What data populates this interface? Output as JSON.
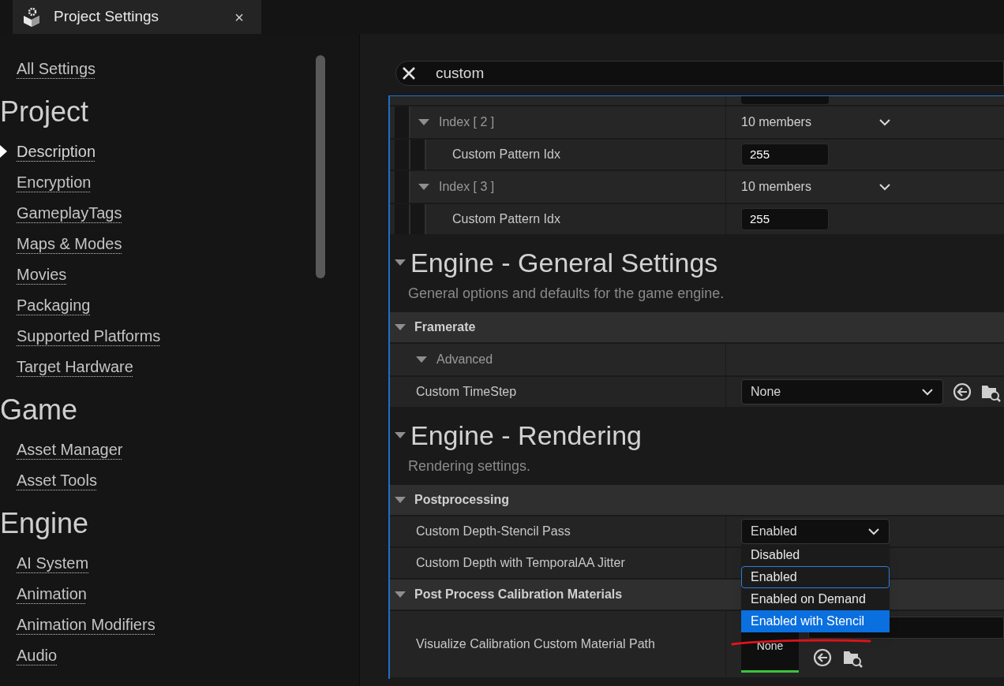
{
  "tab": {
    "title": "Project Settings",
    "close": "×"
  },
  "sidebar": {
    "all_settings": {
      "label": "All Settings",
      "selected": false
    },
    "sections": [
      {
        "title": "Project",
        "items": [
          {
            "label": "Description",
            "selected": true
          },
          {
            "label": "Encryption",
            "selected": false
          },
          {
            "label": "GameplayTags",
            "selected": false
          },
          {
            "label": "Maps & Modes",
            "selected": false
          },
          {
            "label": "Movies",
            "selected": false
          },
          {
            "label": "Packaging",
            "selected": false
          },
          {
            "label": "Supported Platforms",
            "selected": false
          },
          {
            "label": "Target Hardware",
            "selected": false
          }
        ]
      },
      {
        "title": "Game",
        "items": [
          {
            "label": "Asset Manager",
            "selected": false
          },
          {
            "label": "Asset Tools",
            "selected": false
          }
        ]
      },
      {
        "title": "Engine",
        "items": [
          {
            "label": "AI System",
            "selected": false
          },
          {
            "label": "Animation",
            "selected": false
          },
          {
            "label": "Animation Modifiers",
            "selected": false
          },
          {
            "label": "Audio",
            "selected": false
          }
        ]
      }
    ]
  },
  "search": {
    "value": "custom"
  },
  "details": {
    "scrolled_rows": [
      {
        "kind": "group",
        "label": "Index [ 2 ]",
        "value": "10 members",
        "expanded": true,
        "children": [
          {
            "kind": "property",
            "label": "Custom Pattern Idx",
            "value": {
              "kind": "number",
              "text": "255"
            }
          }
        ]
      },
      {
        "kind": "group",
        "label": "Index [ 3 ]",
        "value": "10 members",
        "expanded": true,
        "children": [
          {
            "kind": "property",
            "label": "Custom Pattern Idx",
            "value": {
              "kind": "number",
              "text": "255"
            }
          }
        ]
      }
    ],
    "sections": [
      {
        "title": "Engine - General Settings",
        "description": "General options and defaults for the game engine.",
        "expanded": true,
        "children": [
          {
            "kind": "category",
            "label": "Framerate",
            "expanded": true,
            "children": [
              {
                "kind": "group",
                "label": "Advanced",
                "expanded": true
              },
              {
                "kind": "property",
                "label": "Custom TimeStep",
                "value": {
                  "kind": "class_picker",
                  "text": "None"
                }
              }
            ]
          }
        ]
      },
      {
        "title": "Engine - Rendering",
        "description": "Rendering settings.",
        "expanded": true,
        "children": [
          {
            "kind": "category",
            "label": "Postprocessing",
            "expanded": true,
            "children": [
              {
                "kind": "property",
                "label": "Custom Depth-Stencil Pass",
                "value": {
                  "kind": "combo",
                  "text": "Enabled"
                },
                "open": true,
                "options": [
                  {
                    "label": "Disabled",
                    "selected": false,
                    "hovered": false
                  },
                  {
                    "label": "Enabled",
                    "selected": true,
                    "hovered": false
                  },
                  {
                    "label": "Enabled on Demand",
                    "selected": false,
                    "hovered": false
                  },
                  {
                    "label": "Enabled with Stencil",
                    "selected": false,
                    "hovered": true
                  }
                ]
              },
              {
                "kind": "property",
                "label": "Custom Depth with TemporalAA Jitter"
              }
            ]
          },
          {
            "kind": "category",
            "label": "Post Process Calibration Materials",
            "expanded": true,
            "children": [
              {
                "kind": "property",
                "label": "Visualize Calibration Custom Material Path",
                "value": {
                  "kind": "asset",
                  "text": "None"
                }
              }
            ]
          }
        ]
      }
    ]
  }
}
